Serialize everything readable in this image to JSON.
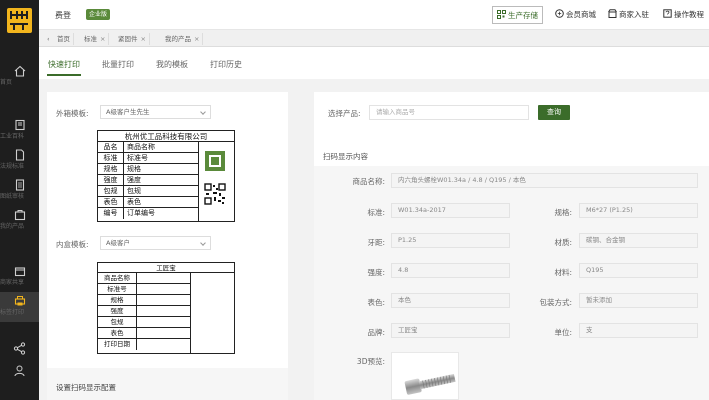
{
  "sidebar": {
    "items": [
      {
        "label": "首页",
        "icon": "home-icon"
      },
      {
        "label": "工业百科",
        "icon": "book-icon"
      },
      {
        "label": "法规标准",
        "icon": "document-icon"
      },
      {
        "label": "图纸审核",
        "icon": "file-icon"
      },
      {
        "label": "我的产品",
        "icon": "product-icon"
      },
      {
        "label": "商家共享",
        "icon": "share-store-icon"
      },
      {
        "label": "标签打印",
        "icon": "printer-icon"
      }
    ],
    "active_index": 6,
    "accent": "#f2b51d"
  },
  "header": {
    "brand": "费登",
    "badge": "企业版",
    "buttons": [
      {
        "label": "生产存储",
        "icon": "qrcode-icon"
      },
      {
        "label": "会员商城",
        "icon": "cart-icon"
      },
      {
        "label": "商家入驻",
        "icon": "store-icon"
      },
      {
        "label": "操作教程",
        "icon": "help-icon"
      }
    ]
  },
  "tabs": [
    {
      "label": "首页",
      "closable": false
    },
    {
      "label": "标准",
      "closable": true
    },
    {
      "label": "紧固件",
      "closable": true
    },
    {
      "label": "我的产品",
      "closable": true
    }
  ],
  "subnav": {
    "tabs": [
      "快速打印",
      "批量打印",
      "我的模板",
      "打印历史"
    ],
    "active_index": 0
  },
  "left": {
    "outer_template_label": "外箱模板:",
    "outer_template_value": "A级客户生先生",
    "outer_label": {
      "title": "杭州优工品科技有限公司",
      "rows": [
        {
          "k": "品名",
          "v": "商品名称"
        },
        {
          "k": "标准",
          "v": "标准号"
        },
        {
          "k": "规格",
          "v": "规格"
        },
        {
          "k": "强度",
          "v": "强度"
        },
        {
          "k": "包规",
          "v": "包规"
        },
        {
          "k": "表色",
          "v": "表色"
        },
        {
          "k": "编号",
          "v": "订单编号"
        }
      ]
    },
    "inner_template_label": "内盒模板:",
    "inner_template_value": "A级客户",
    "inner_label": {
      "title": "工匠宝",
      "rows": [
        "商品名称",
        "标准号",
        "规格",
        "强度",
        "包规",
        "表色",
        "打印日期"
      ]
    },
    "config_title": "设置扫码显示配置"
  },
  "right": {
    "product_label": "选择产品:",
    "product_placeholder": "请输入商品号",
    "query_button": "查询",
    "scan_title": "扫码显示内容",
    "name_label": "商品名称:",
    "name_value": "内六角头螺栓W01.34a / 4.8 / Q195 / 本色",
    "fields": [
      {
        "k1": "标准:",
        "v1": "W01.34a-2017",
        "k2": "规格:",
        "v2": "M6*27 (P1.25)"
      },
      {
        "k1": "牙距:",
        "v1": "P1.25",
        "k2": "材质:",
        "v2": "碳钢、合金钢"
      },
      {
        "k1": "强度:",
        "v1": "4.8",
        "k2": "材料:",
        "v2": "Q195"
      },
      {
        "k1": "表色:",
        "v1": "本色",
        "k2": "包装方式:",
        "v2": "暂未添加"
      },
      {
        "k1": "品牌:",
        "v1": "工匠宝",
        "k2": "单位:",
        "v2": "支"
      }
    ],
    "preview_label": "3D预览:"
  }
}
